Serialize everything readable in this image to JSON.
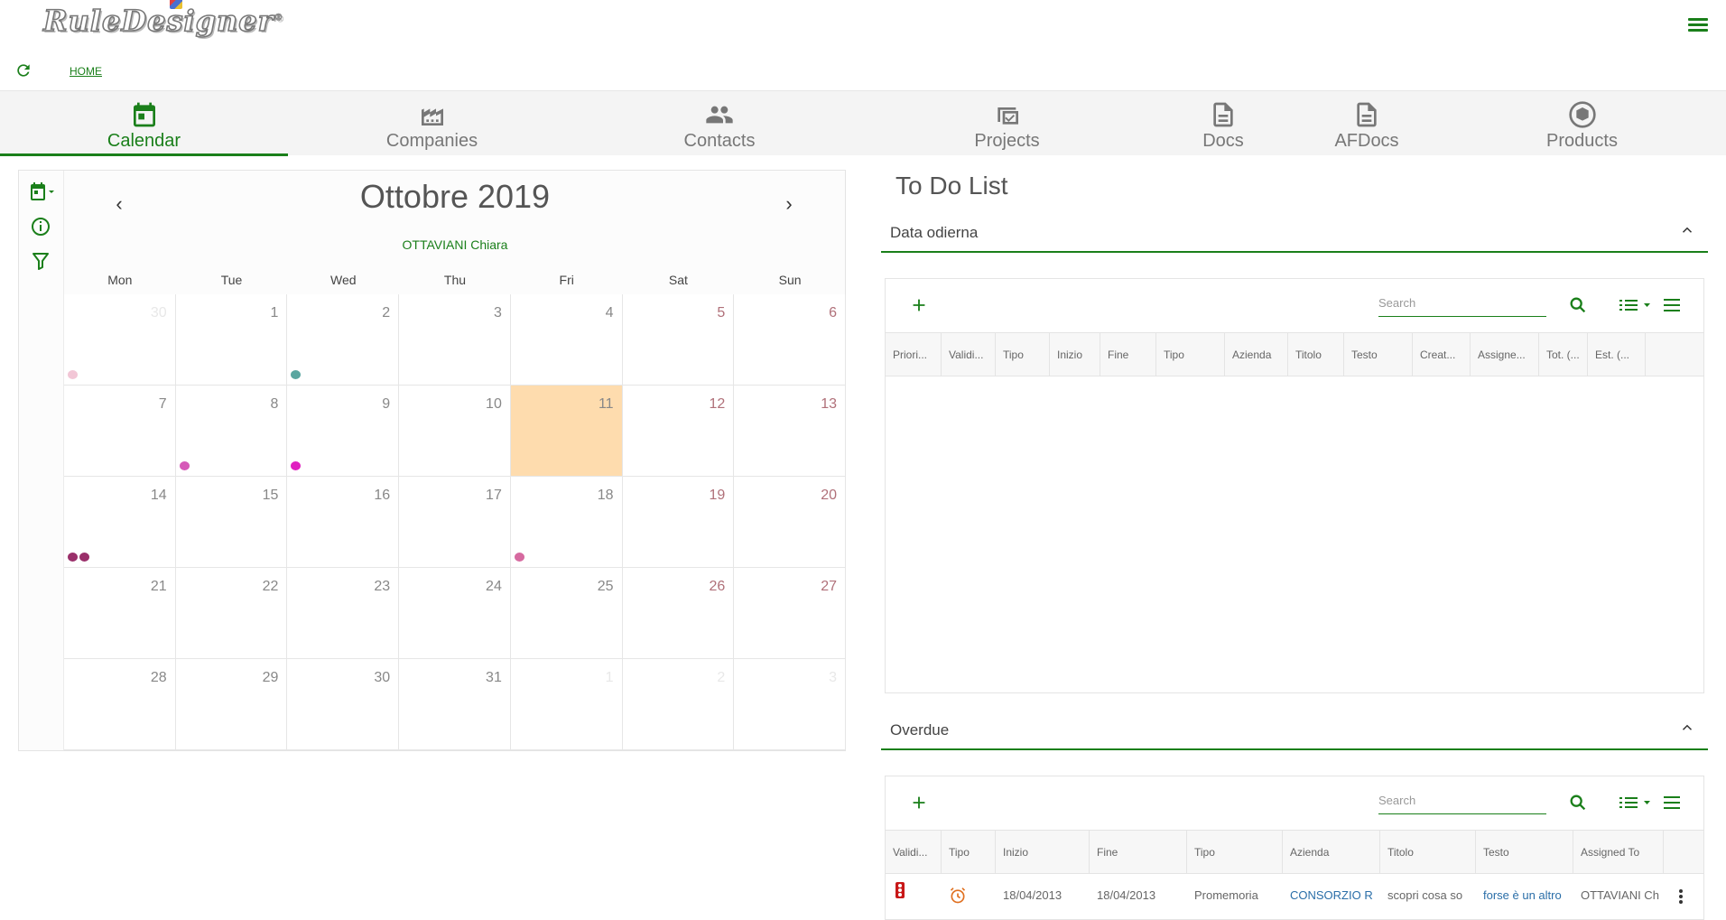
{
  "app": {
    "logo_text": "RuleDesigner",
    "logo_mark": "®"
  },
  "breadcrumb": {
    "home": "HOME"
  },
  "tabs": [
    {
      "label": "Calendar",
      "icon": "calendar-icon",
      "active": true
    },
    {
      "label": "Companies",
      "icon": "factory-icon",
      "active": false
    },
    {
      "label": "Contacts",
      "icon": "people-icon",
      "active": false
    },
    {
      "label": "Projects",
      "icon": "projects-icon",
      "active": false
    },
    {
      "label": "Docs",
      "icon": "document-icon",
      "active": false
    },
    {
      "label": "AFDocs",
      "icon": "document-icon",
      "active": false
    },
    {
      "label": "Products",
      "icon": "box-icon",
      "active": false
    }
  ],
  "calendar": {
    "title": "Ottobre 2019",
    "user": "OTTAVIANI Chiara",
    "weekdays": [
      "Mon",
      "Tue",
      "Wed",
      "Thu",
      "Fri",
      "Sat",
      "Sun"
    ],
    "weeks": [
      [
        "30",
        "1",
        "2",
        "3",
        "4",
        "5",
        "6"
      ],
      [
        "7",
        "8",
        "9",
        "10",
        "11",
        "12",
        "13"
      ],
      [
        "14",
        "15",
        "16",
        "17",
        "18",
        "19",
        "20"
      ],
      [
        "21",
        "22",
        "23",
        "24",
        "25",
        "26",
        "27"
      ],
      [
        "28",
        "29",
        "30",
        "31",
        "1",
        "2",
        "3"
      ]
    ],
    "today": "11",
    "accent_today": "#fedcae",
    "event_colors": [
      "#f2c6d6",
      "#5aa6a0",
      "#d659b8",
      "#e020c0",
      "#9a2f6a",
      "#d66aa0"
    ]
  },
  "todo": {
    "title": "To Do List",
    "today_section": {
      "label": "Data odierna",
      "search_placeholder": "Search",
      "columns": [
        "Priori...",
        "Validi...",
        "Tipo",
        "Inizio",
        "Fine",
        "Tipo",
        "Azienda",
        "Titolo",
        "Testo",
        "Creat...",
        "Assigne...",
        "Tot. (...",
        "Est. (..."
      ]
    },
    "overdue_section": {
      "label": "Overdue",
      "search_placeholder": "Search",
      "columns": [
        "Validi...",
        "Tipo",
        "Inizio",
        "Fine",
        "Tipo",
        "Azienda",
        "Titolo",
        "Testo",
        "Assigned To"
      ],
      "rows": [
        {
          "validity_icon": "traffic-light-icon",
          "type_icon": "alarm-clock-icon",
          "inizio": "18/04/2013",
          "fine": "18/04/2013",
          "tipo": "Promemoria",
          "azienda": "CONSORZIO R",
          "titolo": "scopri cosa so",
          "testo": "forse è un altro",
          "assigned": "OTTAVIANI Ch"
        }
      ]
    }
  },
  "colors": {
    "accent": "#1a7f1a",
    "link": "#2a6ea8"
  }
}
